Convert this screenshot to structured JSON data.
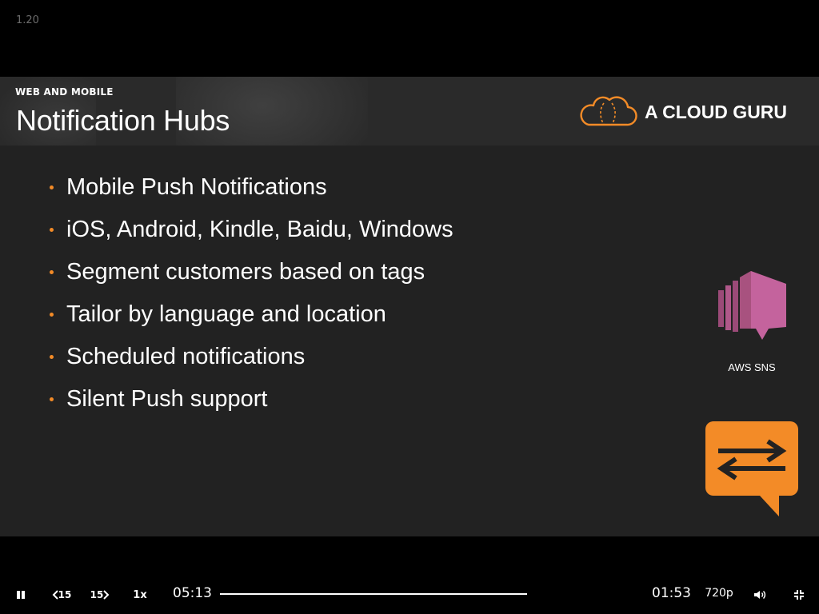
{
  "player": {
    "version": "1.20",
    "speed": "1x",
    "rewind_label": "15",
    "forward_label": "15",
    "current_time": "05:13",
    "remaining_time": "01:53",
    "quality": "720p",
    "progress_fraction": 0.73
  },
  "slide": {
    "tag": "WEB AND MOBILE",
    "title": "Notification Hubs",
    "brand": "A CLOUD GURU",
    "accent_color": "#f38b27",
    "bullets": [
      "Mobile Push Notifications",
      "iOS, Android, Kindle, Baidu, Windows",
      "Segment customers based on tags",
      "Tailor by language and location",
      "Scheduled notifications",
      "Silent Push support"
    ],
    "sns_caption": "AWS SNS",
    "sns_color": "#c4639d"
  }
}
